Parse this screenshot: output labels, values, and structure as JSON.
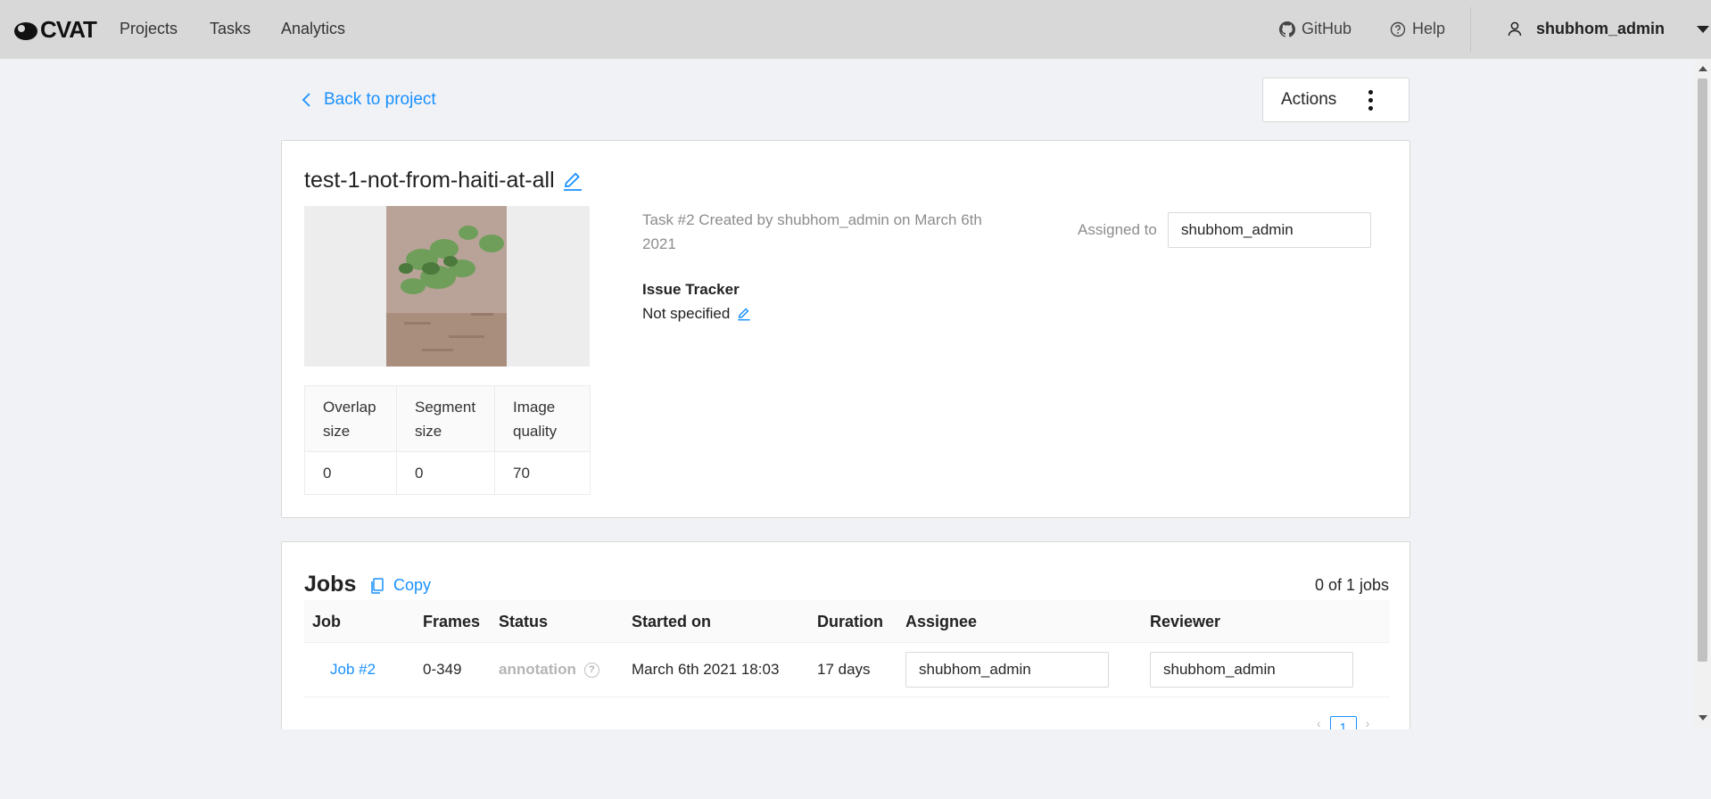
{
  "header": {
    "logo_text": "CVAT",
    "nav": [
      "Projects",
      "Tasks",
      "Analytics"
    ],
    "github": "GitHub",
    "help": "Help",
    "user": "shubhom_admin"
  },
  "page": {
    "back_label": "Back to project",
    "actions_label": "Actions"
  },
  "task": {
    "title": "test-1-not-from-haiti-at-all",
    "info": "Task #2 Created by shubhom_admin on March 6th 2021",
    "issue_tracker_label": "Issue Tracker",
    "issue_tracker_value": "Not specified",
    "assigned_label": "Assigned to",
    "assigned_value": "shubhom_admin",
    "params": {
      "headers": [
        "Overlap size",
        "Segment size",
        "Image quality"
      ],
      "values": [
        "0",
        "0",
        "70"
      ]
    }
  },
  "jobs": {
    "title": "Jobs",
    "copy_label": "Copy",
    "count": "0 of 1 jobs",
    "columns": [
      "Job",
      "Frames",
      "Status",
      "Started on",
      "Duration",
      "Assignee",
      "Reviewer"
    ],
    "rows": [
      {
        "job": "Job #2",
        "frames": "0-349",
        "status": "annotation",
        "started_on": "March 6th 2021 18:03",
        "duration": "17 days",
        "assignee": "shubhom_admin",
        "reviewer": "shubhom_admin"
      }
    ],
    "current_page": "1"
  },
  "colors": {
    "accent": "#1890ff",
    "header_bg": "#d8d8d8",
    "page_bg": "#f1f2f5"
  }
}
